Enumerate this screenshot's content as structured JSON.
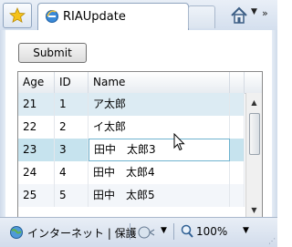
{
  "browser": {
    "tab_title": "RIAUpdate",
    "status_zone": "インターネット | 保護",
    "zoom": "100%"
  },
  "page": {
    "submit_label": "Submit",
    "grid": {
      "columns": [
        "Age",
        "ID",
        "Name"
      ],
      "rows": [
        {
          "age": "21",
          "id": "1",
          "name": "ア太郎"
        },
        {
          "age": "22",
          "id": "2",
          "name": "イ太郎"
        },
        {
          "age": "23",
          "id": "3",
          "name": "田中　太郎3"
        },
        {
          "age": "24",
          "id": "4",
          "name": "田中　太郎4"
        },
        {
          "age": "25",
          "id": "5",
          "name": "田中　太郎5"
        }
      ]
    }
  },
  "icons": {
    "favorites": "star-icon",
    "tab": "ie-page-icon",
    "home": "home-icon",
    "zone": "globe-icon",
    "protected_mode": "protected-mode-icon",
    "zoom": "zoom-icon"
  },
  "colors": {
    "row_hover": "#dcebf3",
    "row_selected": "#c6e3ee",
    "cell_focus_border": "#6fb3cf"
  }
}
